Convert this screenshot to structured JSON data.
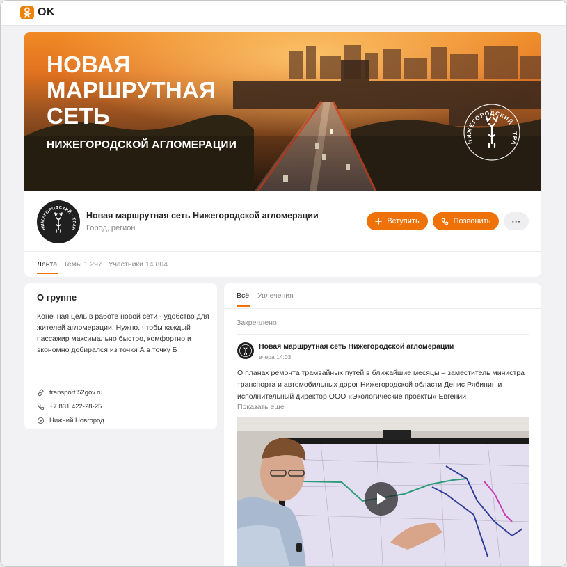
{
  "app": {
    "logo_text": "OK"
  },
  "cover": {
    "title_lines": [
      "НОВАЯ",
      "МАРШРУТНАЯ",
      "СЕТЬ"
    ],
    "subtitle": "НИЖЕГОРОДСКОЙ АГЛОМЕРАЦИИ",
    "emblem_text": "НИЖЕГОРОДСКИЙ · ТРАНСПОРТ"
  },
  "group": {
    "name": "Новая маршрутная сеть Нижегородской агломерации",
    "subtitle": "Город, регион",
    "join_label": "Вступить",
    "call_label": "Позвонить",
    "more_label": "···",
    "avatar_text": "НИЖЕГОРОДСКИЙ · ТРАНСПОРТ"
  },
  "tabs": [
    {
      "label": "Лента",
      "count": ""
    },
    {
      "label": "Темы",
      "count": "1 297"
    },
    {
      "label": "Участники",
      "count": "14 804"
    }
  ],
  "about": {
    "title": "О группе",
    "description": "Конечная цель в работе новой сети - удобство для жителей агломерации. Нужно, чтобы каждый пассажир максимально быстро, комфортно и экономно добирался из точки А в точку Б",
    "website": "transport.52gov.ru",
    "phone": "+7 831 422-28-25",
    "location": "Нижний Новгород"
  },
  "feed": {
    "tabs": [
      "Всё",
      "Увлечения"
    ],
    "pinned_label": "Закреплено",
    "post": {
      "author": "Новая маршрутная сеть Нижегородской агломерации",
      "time": "вчера 14:03",
      "text": "О планах ремонта трамвайных путей в ближайшие месяцы – заместитель министра транспорта и автомобильных дорог Нижегородской области Денис Рябинин и исполнительный директор ООО «Экологические проекты» Евгений",
      "show_more": "Показать еще"
    }
  },
  "colors": {
    "accent": "#ee7208",
    "text": "#333333",
    "muted": "#888888"
  }
}
